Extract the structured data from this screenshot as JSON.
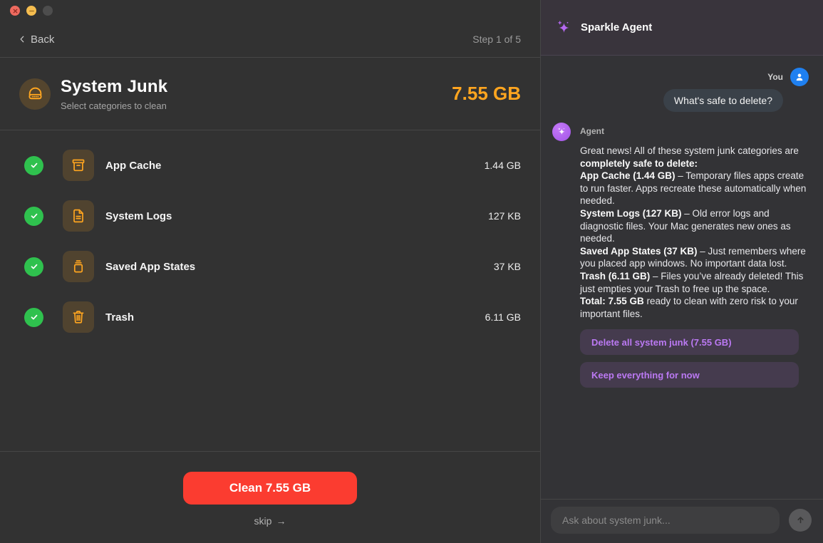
{
  "window": {
    "back_label": "Back",
    "step_label": "Step 1 of 5"
  },
  "header": {
    "title": "System Junk",
    "subtitle": "Select categories to clean",
    "total_size": "7.55 GB"
  },
  "categories": [
    {
      "name": "App Cache",
      "size": "1.44 GB",
      "icon": "archive-box-icon",
      "checked": true
    },
    {
      "name": "System Logs",
      "size": "127 KB",
      "icon": "document-icon",
      "checked": true
    },
    {
      "name": "Saved App States",
      "size": "37 KB",
      "icon": "app-states-icon",
      "checked": true
    },
    {
      "name": "Trash",
      "size": "6.11 GB",
      "icon": "trash-icon",
      "checked": true
    }
  ],
  "footer": {
    "clean_button_label": "Clean 7.55 GB",
    "skip_label": "skip",
    "skip_arrow": "→"
  },
  "chat": {
    "title": "Sparkle Agent",
    "user_label": "You",
    "user_message": "What's safe to delete?",
    "agent_label": "Agent",
    "agent_message_segments": [
      {
        "text": "Great news! All of these system junk categories are ",
        "bold": false
      },
      {
        "text": "completely safe to delete:",
        "bold": true
      },
      {
        "text": "\n",
        "bold": false
      },
      {
        "text": "App Cache (1.44 GB)",
        "bold": true
      },
      {
        "text": " – Temporary files apps create to run faster. Apps recreate these automatically when needed.",
        "bold": false
      },
      {
        "text": "\n",
        "bold": false
      },
      {
        "text": "System Logs (127 KB)",
        "bold": true
      },
      {
        "text": " – Old error logs and diagnostic files. Your Mac generates new ones as needed.",
        "bold": false
      },
      {
        "text": "\n",
        "bold": false
      },
      {
        "text": "Saved App States (37 KB)",
        "bold": true
      },
      {
        "text": " – Just remembers where you placed app windows. No important data lost.",
        "bold": false
      },
      {
        "text": "\n",
        "bold": false
      },
      {
        "text": "Trash (6.11 GB)",
        "bold": true
      },
      {
        "text": " – Files you’ve already deleted! This just empties your Trash to free up the space.",
        "bold": false
      },
      {
        "text": "\n",
        "bold": false
      },
      {
        "text": "Total: 7.55 GB",
        "bold": true
      },
      {
        "text": " ready to clean with zero risk to your important files.",
        "bold": false
      }
    ],
    "action_buttons": [
      "Delete all system junk (7.55 GB)",
      "Keep everything for now"
    ],
    "input_placeholder": "Ask about system junk..."
  },
  "colors": {
    "accent_orange": "#ffa51f",
    "accent_red": "#fb3c30",
    "accent_green": "#2fc14e",
    "accent_purple": "#bb79f3",
    "accent_blue": "#1f80f0"
  }
}
